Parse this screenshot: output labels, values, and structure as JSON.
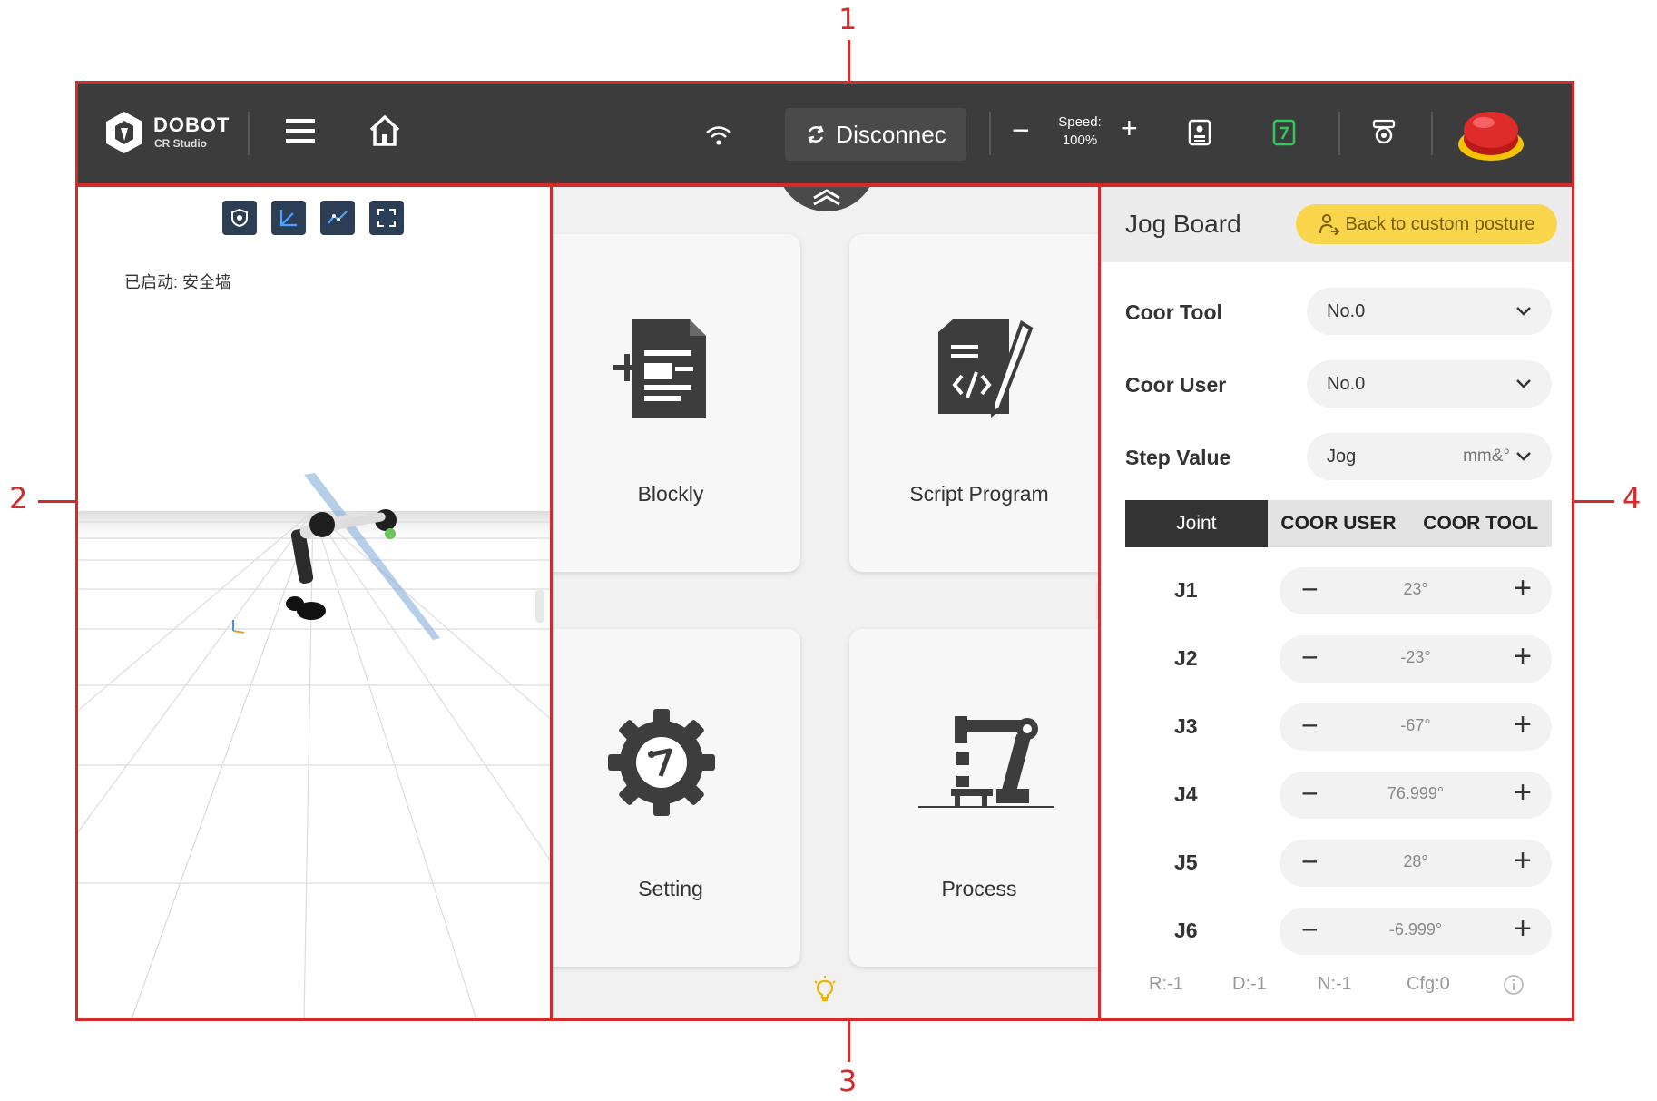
{
  "callouts": [
    "1",
    "2",
    "3",
    "4"
  ],
  "colors": {
    "topbar": "#3c3c3c",
    "annotation": "#d42a2a",
    "accent_yellow": "#f8d54a",
    "estop_red": "#e02b2b",
    "active_tab": "#333333"
  },
  "topbar": {
    "logo_name": "DOBOT",
    "logo_sub": "CR Studio",
    "menu_icon": "hamburger-menu-icon",
    "home_icon": "home-icon",
    "wifi_icon": "wifi-icon",
    "disconnect_label": "Disconnec",
    "speed_label_line1": "Speed:",
    "speed_label_line2": "100%",
    "speed_minus": "−",
    "speed_plus": "+"
  },
  "scene": {
    "status_text": "已启动: 安全墙",
    "tools": [
      "shield-icon",
      "axis-icon",
      "trajectory-icon",
      "fullscreen-icon"
    ]
  },
  "modules": [
    {
      "label": "Blockly",
      "icon": "blockly-document-icon"
    },
    {
      "label": "Script Program",
      "icon": "script-code-icon"
    },
    {
      "label": "Setting",
      "icon": "robot-gear-icon"
    },
    {
      "label": "Process",
      "icon": "robot-arm-icon"
    }
  ],
  "jog": {
    "title": "Jog Board",
    "back_button": "Back to custom posture",
    "fields": [
      {
        "label": "Coor Tool",
        "value": "No.0",
        "unit": ""
      },
      {
        "label": "Coor User",
        "value": "No.0",
        "unit": ""
      },
      {
        "label": "Step Value",
        "value": "Jog",
        "unit": "mm&°"
      }
    ],
    "tabs": [
      {
        "label": "Joint",
        "active": true
      },
      {
        "label": "COOR USER",
        "active": false
      },
      {
        "label": "COOR TOOL",
        "active": false
      }
    ],
    "joints": [
      {
        "name": "J1",
        "value": "23°"
      },
      {
        "name": "J2",
        "value": "-23°"
      },
      {
        "name": "J3",
        "value": "-67°"
      },
      {
        "name": "J4",
        "value": "76.999°"
      },
      {
        "name": "J5",
        "value": "28°"
      },
      {
        "name": "J6",
        "value": "-6.999°"
      }
    ],
    "status": {
      "r": "R:-1",
      "d": "D:-1",
      "n": "N:-1",
      "cfg": "Cfg:0"
    }
  }
}
